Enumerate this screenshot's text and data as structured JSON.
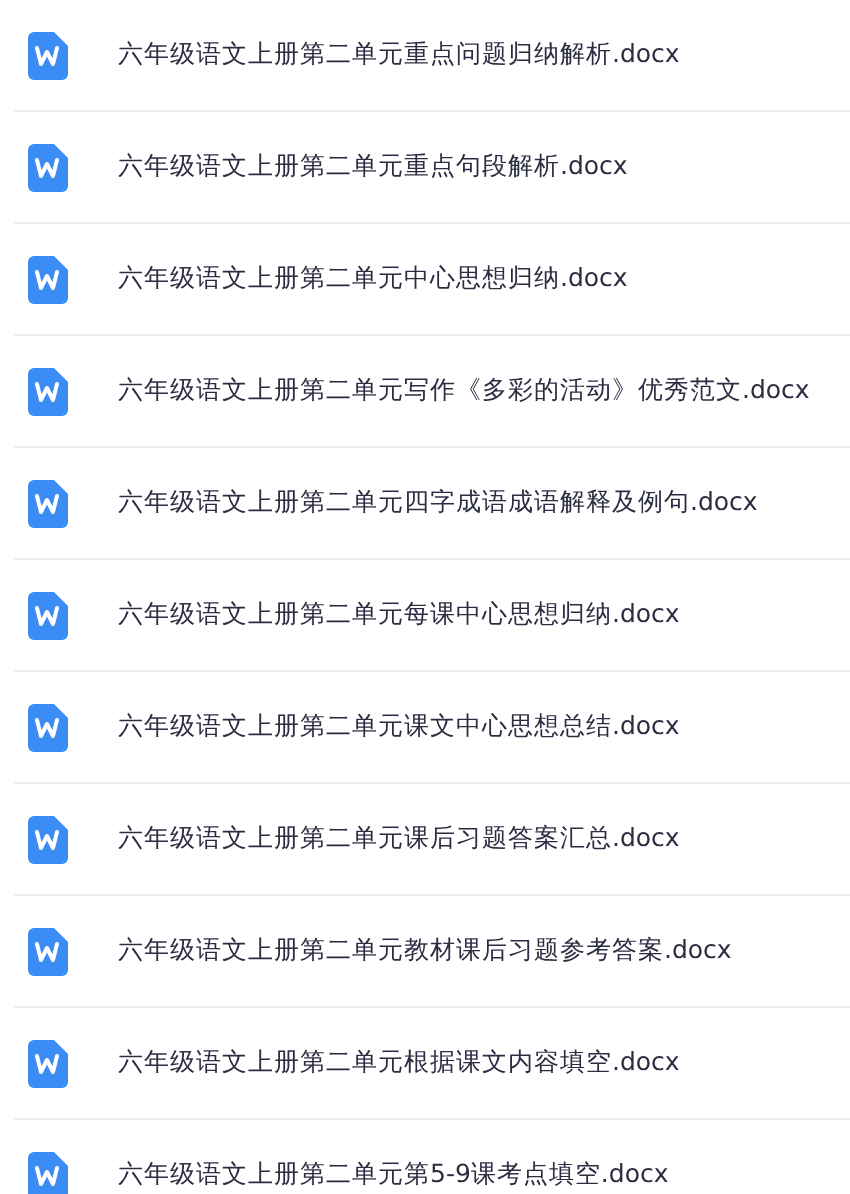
{
  "files": [
    {
      "name": "六年级语文上册第二单元重点问题归纳解析.docx"
    },
    {
      "name": "六年级语文上册第二单元重点句段解析.docx"
    },
    {
      "name": "六年级语文上册第二单元中心思想归纳.docx"
    },
    {
      "name": "六年级语文上册第二单元写作《多彩的活动》优秀范文.docx"
    },
    {
      "name": "六年级语文上册第二单元四字成语成语解释及例句.docx"
    },
    {
      "name": "六年级语文上册第二单元每课中心思想归纳.docx"
    },
    {
      "name": "六年级语文上册第二单元课文中心思想总结.docx"
    },
    {
      "name": "六年级语文上册第二单元课后习题答案汇总.docx"
    },
    {
      "name": "六年级语文上册第二单元教材课后习题参考答案.docx"
    },
    {
      "name": "六年级语文上册第二单元根据课文内容填空.docx"
    },
    {
      "name": "六年级语文上册第二单元第5-9课考点填空.docx"
    }
  ]
}
